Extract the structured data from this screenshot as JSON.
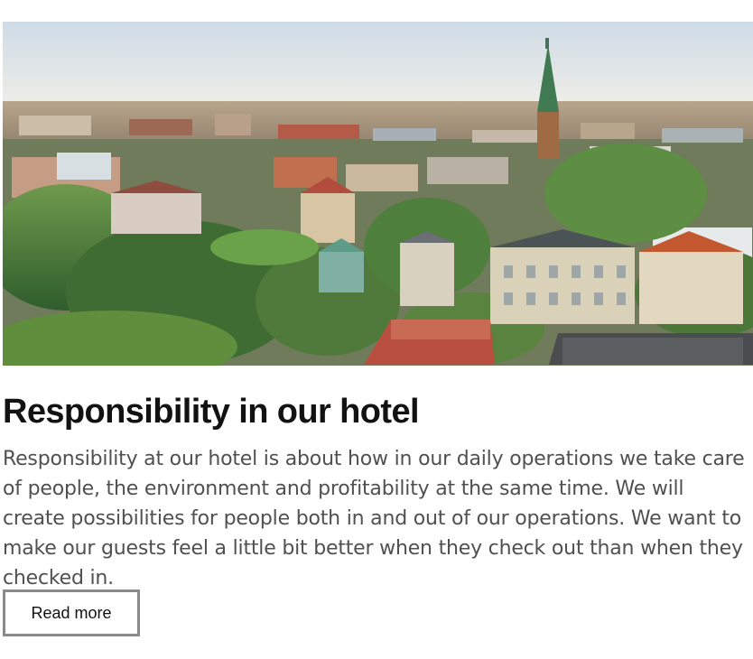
{
  "article": {
    "title": "Responsibility in our hotel",
    "body": "Responsibility at our hotel is about how in our daily operations we take care of people, the environment and profitability at the same time. We will create possibilities for people both in and out of our operations. We want to make our guests feel a little bit better when they check out than when they checked in.",
    "button_label": "Read more"
  },
  "image": {
    "subject": "city-aerial-photo"
  },
  "colors": {
    "title": "#121212",
    "body_text": "#505050",
    "button_border": "#8a8a8a",
    "background": "#ffffff"
  }
}
